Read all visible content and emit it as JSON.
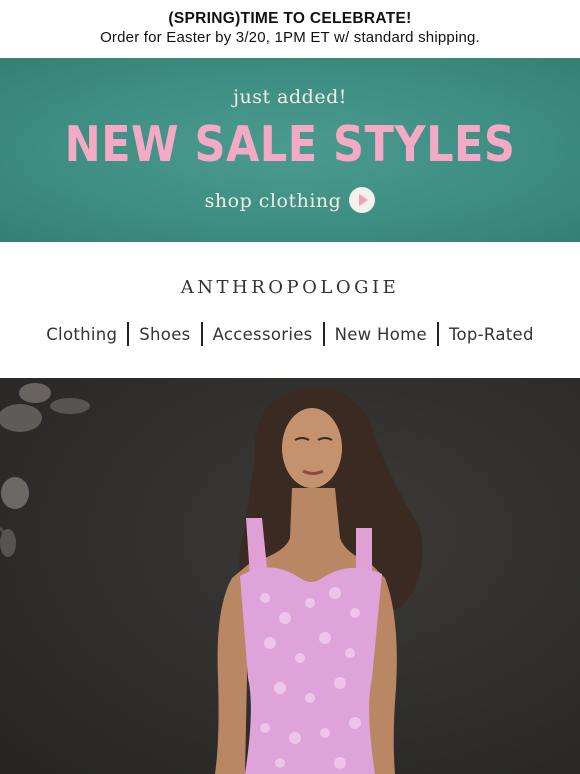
{
  "topbar": {
    "headline": "(SPRING)TIME TO CELEBRATE!",
    "subline": "Order for Easter by 3/20, 1PM ET w/ standard shipping."
  },
  "banner": {
    "tag": "just added!",
    "title": "NEW SALE STYLES",
    "cta": "shop clothing",
    "cta_icon": "play-circle-icon",
    "colors": {
      "background": "#3e8f83",
      "title": "#f4a9c4",
      "text": "#f2efe6"
    }
  },
  "brand": {
    "name": "ANTHROPOLOGIE"
  },
  "nav": {
    "items": [
      {
        "label": "Clothing"
      },
      {
        "label": "Shoes"
      },
      {
        "label": "Accessories"
      },
      {
        "label": "New Home"
      },
      {
        "label": "Top-Rated"
      }
    ]
  },
  "hero": {
    "image": "model-in-pink-floral-dress",
    "colors": {
      "background": "#2e2d2b",
      "dress": "#e0a0d8"
    }
  }
}
